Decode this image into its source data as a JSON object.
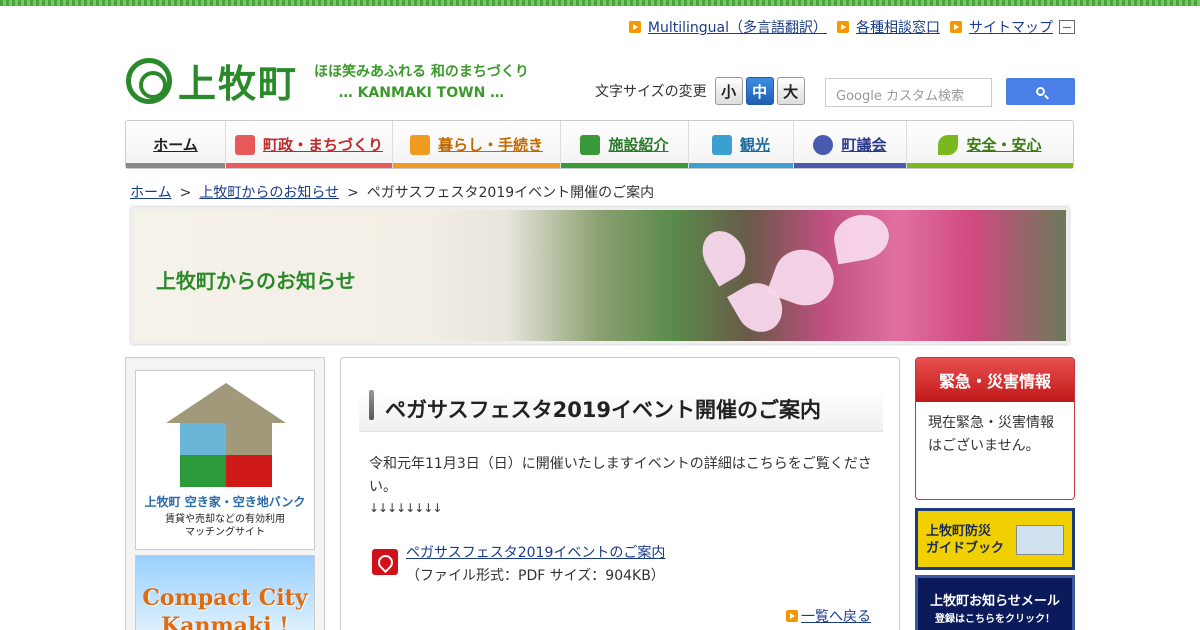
{
  "top_links": [
    {
      "label": "Multilingual（多言語翻訳）"
    },
    {
      "label": "各種相談窓口"
    },
    {
      "label": "サイトマップ"
    }
  ],
  "logo": {
    "name": "上牧町",
    "tagline": "ほほ笑みあふれる 和のまちづくり",
    "subtitle": "… KANMAKI TOWN …"
  },
  "font_size": {
    "label": "文字サイズの変更",
    "options": [
      "小",
      "中",
      "大"
    ],
    "selected": "中"
  },
  "search": {
    "placeholder": "Google カスタム検索"
  },
  "nav": [
    {
      "label": "ホーム",
      "color": "#888888"
    },
    {
      "label": "町政・まちづくり",
      "color": "#e85a5a"
    },
    {
      "label": "暮らし・手続き",
      "color": "#f09a20"
    },
    {
      "label": "施設紹介",
      "color": "#3a9a3a"
    },
    {
      "label": "観光",
      "color": "#3aa0d0"
    },
    {
      "label": "町議会",
      "color": "#4a5ab0"
    },
    {
      "label": "安全・安心",
      "color": "#7ab820"
    }
  ],
  "breadcrumb": {
    "home": "ホーム",
    "section": "上牧町からのお知らせ",
    "current": "ペガサスフェスタ2019イベント開催のご案内",
    "sep": ">"
  },
  "banner": {
    "title": "上牧町からのお知らせ"
  },
  "left": {
    "bank_title": "上牧町 空き家・空き地バンク",
    "bank_sub1": "賃貸や売却などの有効利用",
    "bank_sub2": "マッチングサイト",
    "compact_line1": "Compact City",
    "compact_line2": "Kanmaki !"
  },
  "article": {
    "title": "ペガサスフェスタ2019イベント開催のご案内",
    "body": "令和元年11月3日（日）に開催いたしますイベントの詳細はこちらをご覧ください。",
    "arrows": "↓↓↓↓↓↓↓↓",
    "pdf_link": "ペガサスフェスタ2019イベントのご案内",
    "pdf_info": "（ファイル形式：PDF サイズ：904KB）",
    "back": "一覧へ戻る"
  },
  "right": {
    "emergency_title": "緊急・災害情報",
    "emergency_body": "現在緊急・災害情報はございません。",
    "guide_line1": "上牧町防災",
    "guide_line2": "ガイドブック",
    "mail_line1": "上牧町お知らせメール",
    "mail_line2": "登録はこちらをクリック！"
  }
}
